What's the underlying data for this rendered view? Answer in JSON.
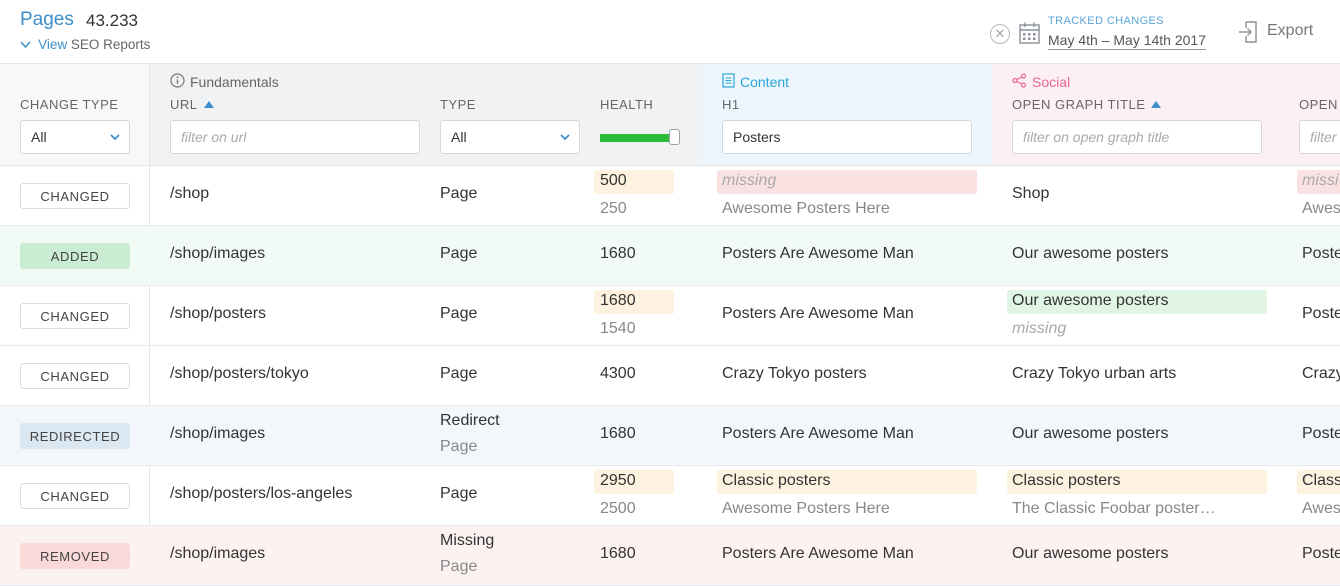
{
  "header": {
    "title": "Pages",
    "count": "43.233",
    "seo_link_prefix": "View",
    "seo_link_label": "SEO Reports",
    "tracked_label": "TRACKED CHANGES",
    "tracked_range": "May 4th – May 14th 2017",
    "export_label": "Export"
  },
  "groups": {
    "fundamentals": "Fundamentals",
    "content": "Content",
    "social": "Social"
  },
  "columns": {
    "change_type": "CHANGE TYPE",
    "url": "URL",
    "type": "TYPE",
    "health": "HEALTH",
    "h1": "H1",
    "og_title": "OPEN GRAPH TITLE",
    "og_next": "OPEN"
  },
  "filters": {
    "change_type_value": "All",
    "url_placeholder": "filter on url",
    "type_value": "All",
    "health_level": 0.92,
    "h1_value": "Posters",
    "og_title_placeholder": "filter on open graph title",
    "og_next_placeholder": "filter"
  },
  "rows": [
    {
      "change": "CHANGED",
      "url": "/shop",
      "type": "Page",
      "health": "500",
      "health_prev": "250",
      "h1": "missing",
      "h1_prev": "Awesome Posters Here",
      "og": "Shop",
      "og_next": "missi",
      "og_next_prev": "Awes"
    },
    {
      "change": "ADDED",
      "url": "/shop/images",
      "type": "Page",
      "health": "1680",
      "h1": "Posters Are Awesome Man",
      "og": "Our awesome posters",
      "og_next": "Poste"
    },
    {
      "change": "CHANGED",
      "url": "/shop/posters",
      "type": "Page",
      "health": "1680",
      "health_prev": "1540",
      "h1": "Posters Are Awesome Man",
      "og": "Our awesome posters",
      "og_prev": "missing",
      "og_next": "Poste"
    },
    {
      "change": "CHANGED",
      "url": "/shop/posters/tokyo",
      "type": "Page",
      "health": "4300",
      "h1": "Crazy Tokyo posters",
      "og": "Crazy Tokyo urban arts",
      "og_next": "Crazy"
    },
    {
      "change": "REDIRECTED",
      "url": "/shop/images",
      "type": "Redirect",
      "type_prev": "Page",
      "health": "1680",
      "h1": "Posters Are Awesome Man",
      "og": "Our awesome posters",
      "og_next": "Poste"
    },
    {
      "change": "CHANGED",
      "url": "/shop/posters/los-angeles",
      "type": "Page",
      "health": "2950",
      "health_prev": "2500",
      "h1": "Classic posters",
      "h1_prev": "Awesome Posters Here",
      "og": "Classic posters",
      "og_prev": "The Classic Foobar poster…",
      "og_next": "Class",
      "og_next_prev": "Awes"
    },
    {
      "change": "REMOVED",
      "url": "/shop/images",
      "type": "Missing",
      "type_prev": "Page",
      "health": "1680",
      "h1": "Posters Are Awesome Man",
      "og": "Our awesome posters",
      "og_next": "Poste"
    }
  ],
  "colors": {
    "accent": "#3d8ec9",
    "content_accent": "#2aa6d9",
    "social_accent": "#e8679a",
    "health_green": "#2bbb3a",
    "added_bg": "#c9ecd2",
    "redirected_bg": "#dbe7f1",
    "removed_bg": "#fad9d9"
  },
  "icons": {
    "clear": "close-circle-icon",
    "calendar": "calendar-icon",
    "export": "export-icon",
    "fundamentals": "info-icon",
    "content": "document-icon",
    "social": "share-icon"
  }
}
